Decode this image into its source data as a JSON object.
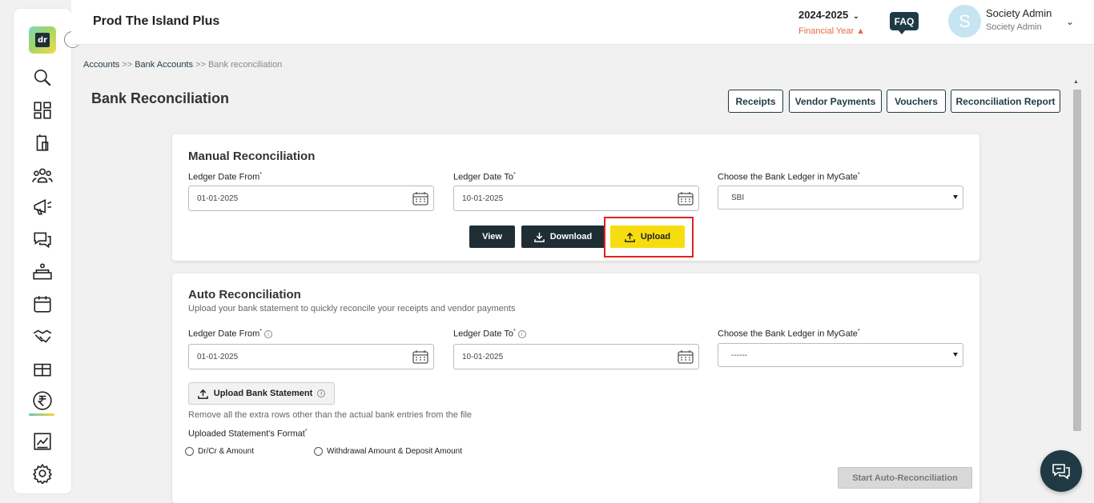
{
  "header": {
    "app_title": "Prod The Island Plus",
    "financial_year": "2024-2025",
    "financial_year_label": "Financial Year",
    "faq": "FAQ",
    "avatar_letter": "S",
    "user_name": "Society Admin",
    "user_role": "Society Admin"
  },
  "breadcrumb": {
    "item1": "Accounts",
    "sep1": " >> ",
    "item2": "Bank Accounts",
    "sep2": " >> ",
    "current": "Bank reconciliation"
  },
  "page": {
    "title": "Bank Reconciliation",
    "buttons": {
      "receipts": "Receipts",
      "vendor_payments": "Vendor Payments",
      "vouchers": "Vouchers",
      "reconciliation_report": "Reconciliation Report"
    }
  },
  "manual": {
    "title": "Manual Reconciliation",
    "from_label": "Ledger Date From",
    "to_label": "Ledger Date To",
    "ledger_label": "Choose the Bank Ledger in MyGate",
    "required_mark": "*",
    "from_value": "01-01-2025",
    "to_value": "10-01-2025",
    "ledger_value": "SBI",
    "view": "View",
    "download": "Download",
    "upload": "Upload"
  },
  "auto": {
    "title": "Auto Reconciliation",
    "subtitle": "Upload your bank statement to quickly reconcile your receipts and vendor payments",
    "from_label": "Ledger Date From",
    "to_label": "Ledger Date To",
    "ledger_label": "Choose the Bank Ledger in MyGate",
    "required_mark": "*",
    "from_value": "01-01-2025",
    "to_value": "10-01-2025",
    "ledger_value": "------",
    "upload_statement": "Upload Bank Statement",
    "upload_hint": "Remove all the extra rows other than the actual bank entries from the file",
    "format_label": "Uploaded Statement's Format",
    "format_option1": "Dr/Cr & Amount",
    "format_option2": "Withdrawal Amount & Deposit Amount",
    "start": "Start Auto-Reconciliation"
  },
  "colors": {
    "primary_dark": "#1f2d35",
    "accent_yellow": "#f7dd0f",
    "financial_year_orange": "#e46b3f",
    "highlight_red": "#e02020"
  }
}
